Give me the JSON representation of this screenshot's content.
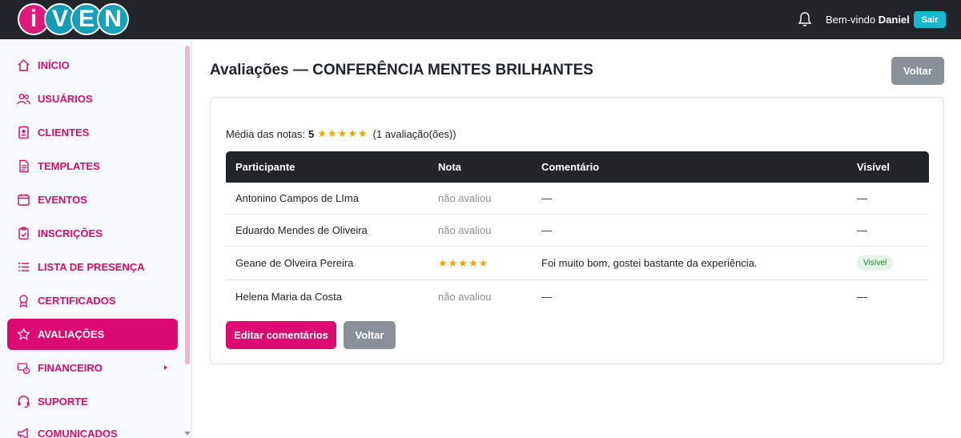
{
  "header": {
    "logo_letters": [
      "i",
      "V",
      "E",
      "N"
    ],
    "welcome_prefix": "Bem-vindo",
    "username": "Daniel",
    "logout_label": "Sair"
  },
  "sidebar": {
    "items": [
      {
        "label": "INÍCIO",
        "icon": "home-icon"
      },
      {
        "label": "USUÁRIOS",
        "icon": "users-icon"
      },
      {
        "label": "CLIENTES",
        "icon": "client-card-icon"
      },
      {
        "label": "TEMPLATES",
        "icon": "document-icon"
      },
      {
        "label": "EVENTOS",
        "icon": "calendar-icon"
      },
      {
        "label": "INSCRIÇÕES",
        "icon": "clipboard-check-icon"
      },
      {
        "label": "LISTA DE PRESENÇA",
        "icon": "list-icon"
      },
      {
        "label": "CERTIFICADOS",
        "icon": "award-icon"
      },
      {
        "label": "AVALIAÇÕES",
        "icon": "star-icon",
        "active": true
      },
      {
        "label": "FINANCEIRO",
        "icon": "money-icon",
        "has_submenu": true
      },
      {
        "label": "SUPORTE",
        "icon": "headset-icon"
      },
      {
        "label": "COMUNICADOS",
        "icon": "megaphone-icon"
      }
    ]
  },
  "main": {
    "title": "Avaliações — CONFERÊNCIA MENTES BRILHANTES",
    "back_label": "Voltar",
    "average": {
      "label": "Média das notas:",
      "value": "5",
      "stars": "★★★★★",
      "count_text": "(1 avaliação(ões))"
    },
    "table": {
      "columns": [
        "Participante",
        "Nota",
        "Comentário",
        "Visível"
      ],
      "rows": [
        {
          "participant": "Antonino Campos de LIma",
          "rating": "não avaliou",
          "comment": "—",
          "visible": "—"
        },
        {
          "participant": "Eduardo Mendes de Oliveira",
          "rating": "não avaliou",
          "comment": "—",
          "visible": "—"
        },
        {
          "participant": "Geane de Olveira Pereira",
          "rating": "★★★★★",
          "comment": "Foi muito bom, gostei bastante da experiência.",
          "visible": "Visível"
        },
        {
          "participant": "Helena Maria da Costa",
          "rating": "não avaliou",
          "comment": "—",
          "visible": "—"
        }
      ]
    },
    "edit_comments_label": "Editar comentários",
    "back_bottom_label": "Voltar"
  },
  "colors": {
    "brand_pink": "#dc0b73",
    "brand_teal": "#17b7cf",
    "star": "#f0a500",
    "dark": "#212529"
  }
}
